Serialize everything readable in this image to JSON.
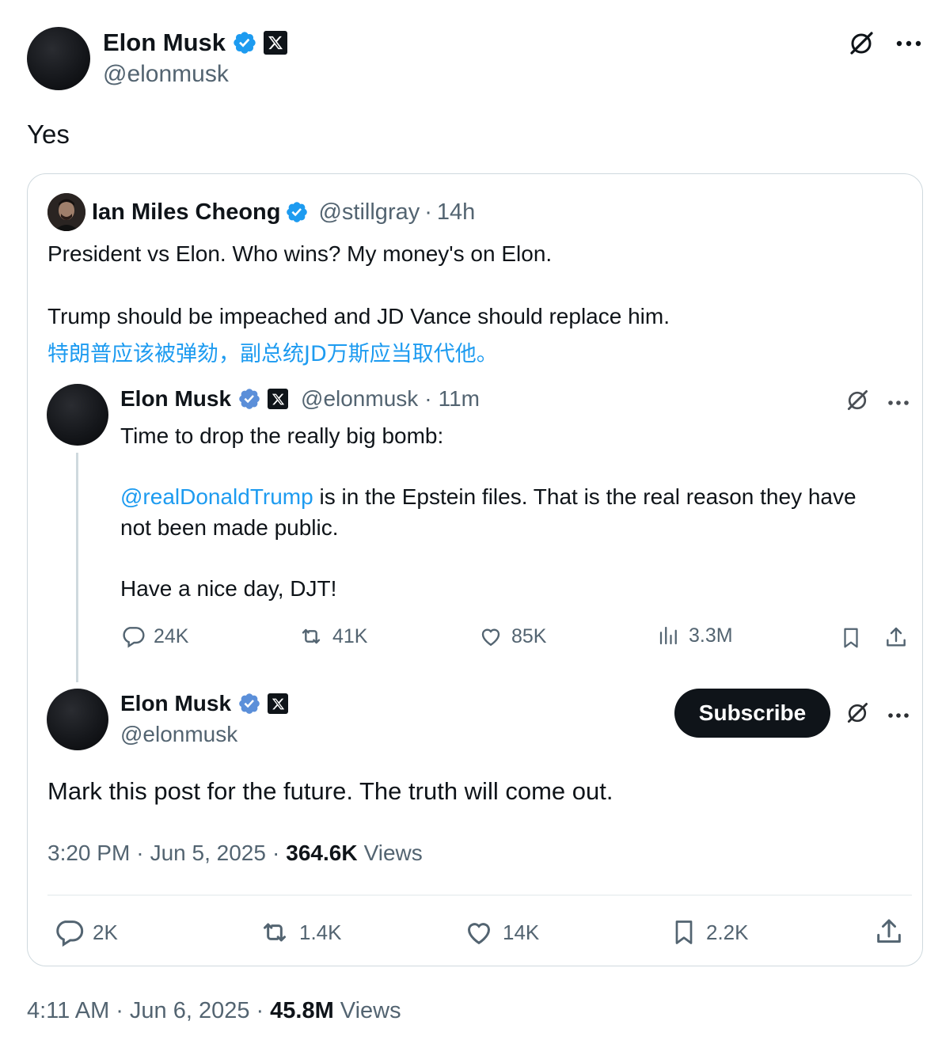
{
  "main_post": {
    "author_name": "Elon Musk",
    "handle": "@elonmusk",
    "text": "Yes",
    "time": "4:11 AM",
    "sep1": "·",
    "date": "Jun 6, 2025",
    "sep2": "·",
    "views_count": "45.8M",
    "views_label": "Views",
    "icons": {
      "grok": "grok-icon",
      "more": "more-icon"
    }
  },
  "quote": {
    "author_name": "Ian Miles Cheong",
    "handle": "@stillgray",
    "sep": "·",
    "age": "14h",
    "line1": "President vs Elon. Who wins? My money's on Elon.",
    "line2": "Trump should be impeached and JD Vance should replace him.",
    "translation": "特朗普应该被弹劾，副总统JD万斯应当取代他。"
  },
  "screenshot_post1": {
    "author_name": "Elon Musk",
    "handle": "@elonmusk",
    "sep": "·",
    "age": "11m",
    "line1": "Time to drop the really big bomb:",
    "mention": "@realDonaldTrump",
    "line2_rest": " is in the Epstein files. That is the real reason they have",
    "line3": "not been made public.",
    "line4": "Have a nice day, DJT!",
    "replies": "24K",
    "reposts": "41K",
    "likes": "85K",
    "views": "3.3M"
  },
  "screenshot_post2": {
    "author_name": "Elon Musk",
    "handle": "@elonmusk",
    "subscribe_label": "Subscribe",
    "text": "Mark this post for the future. The truth will come out.",
    "time": "3:20 PM",
    "sep1": "·",
    "date": "Jun 5, 2025",
    "sep2": "·",
    "views_count": "364.6K",
    "views_label": "Views",
    "replies": "2K",
    "reposts": "1.4K",
    "likes": "14K",
    "bookmarks": "2.2K"
  },
  "colors": {
    "text": "#0f1419",
    "muted": "#536471",
    "link": "#1d9bf0",
    "verified": "#1d9bf0",
    "border": "#cfd9de"
  }
}
